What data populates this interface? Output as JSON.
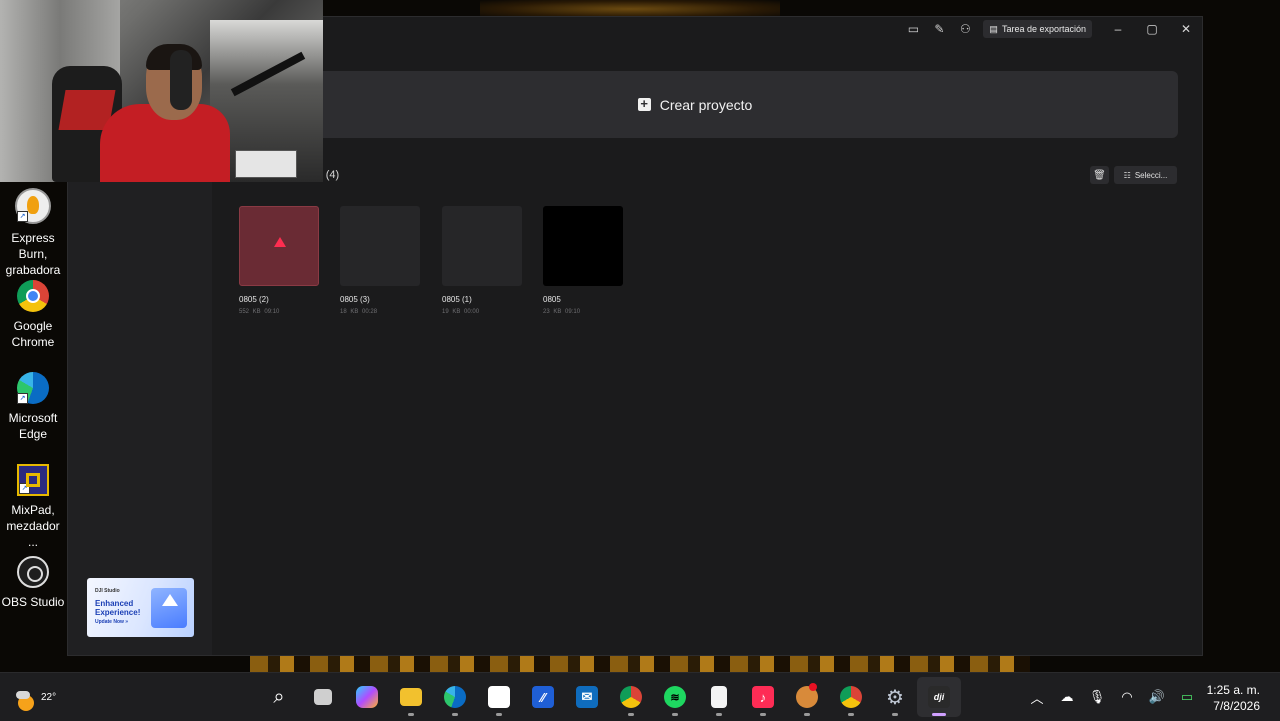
{
  "window": {
    "export_task_label": "Tarea de exportación",
    "minimize": "–",
    "maximize": "▢",
    "close": "✕"
  },
  "main": {
    "create_project_label": "Crear proyecto",
    "section_title": "tes (4)",
    "select_label": "Selecci..."
  },
  "projects": [
    {
      "name": "0805 (2)",
      "size": "552 KB",
      "duration": "09:10",
      "thumb": "error"
    },
    {
      "name": "0805 (3)",
      "size": "18 KB",
      "duration": "00:28",
      "thumb": "empty"
    },
    {
      "name": "0805 (1)",
      "size": "19 KB",
      "duration": "00:00",
      "thumb": "empty"
    },
    {
      "name": "0805",
      "size": "23 KB",
      "duration": "09:10",
      "thumb": "black"
    }
  ],
  "promo": {
    "brand": "DJI Studio",
    "headline": "Enhanced Experience!",
    "cta": "Update Now »"
  },
  "desktop_icons": [
    {
      "label_line1": "Express Burn,",
      "label_line2": "grabadora ...",
      "icon": "express-burn-icon"
    },
    {
      "label_line1": "Google",
      "label_line2": "Chrome",
      "icon": "chrome-icon"
    },
    {
      "label_line1": "Microsoft",
      "label_line2": "Edge",
      "icon": "edge-icon"
    },
    {
      "label_line1": "MixPad,",
      "label_line2": "mezdador ...",
      "icon": "mixpad-icon"
    },
    {
      "label_line1": "OBS Studio",
      "label_line2": "",
      "icon": "obs-icon"
    }
  ],
  "taskbar": {
    "temperature": "22°",
    "time": "1:25 a. m.",
    "date": "7/8/2026",
    "apps": [
      "start-icon",
      "search-icon",
      "task-view-icon",
      "copilot-icon",
      "file-explorer-icon",
      "edge-icon",
      "store-icon",
      "word-icon",
      "outlook-icon",
      "chrome-icon",
      "spotify-icon",
      "notepad-icon",
      "tiktok-icon",
      "app-badge-icon",
      "chrome-icon",
      "settings-icon",
      "dji-icon"
    ]
  },
  "colors": {
    "window_bg": "#1b1b1c",
    "create_bar_bg": "#2d2d30",
    "error_thumb": "#6a2b34",
    "warning": "#ff2d50"
  }
}
